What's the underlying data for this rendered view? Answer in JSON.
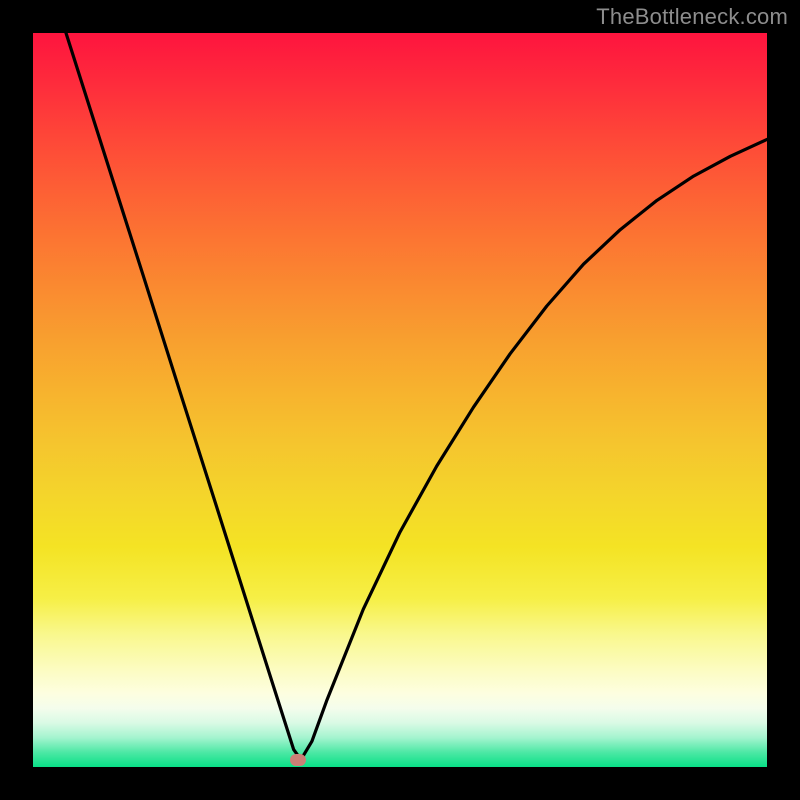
{
  "watermark": "TheBottleneck.com",
  "marker": {
    "x_frac": 0.3615,
    "y_frac": 0.9905
  },
  "chart_data": {
    "type": "line",
    "title": "",
    "xlabel": "",
    "ylabel": "",
    "xlim": [
      0,
      1
    ],
    "ylim": [
      0,
      1
    ],
    "series": [
      {
        "name": "bottleneck-curve",
        "x": [
          0.045,
          0.1,
          0.15,
          0.2,
          0.25,
          0.3,
          0.325,
          0.34,
          0.355,
          0.365,
          0.38,
          0.4,
          0.45,
          0.5,
          0.55,
          0.6,
          0.65,
          0.7,
          0.75,
          0.8,
          0.85,
          0.9,
          0.95,
          1.0
        ],
        "y": [
          1.0,
          0.827,
          0.67,
          0.512,
          0.355,
          0.197,
          0.118,
          0.071,
          0.024,
          0.01,
          0.035,
          0.09,
          0.215,
          0.32,
          0.41,
          0.49,
          0.563,
          0.628,
          0.685,
          0.732,
          0.772,
          0.805,
          0.832,
          0.855
        ]
      }
    ],
    "annotations": [
      {
        "name": "watermark",
        "text": "TheBottleneck.com",
        "pos": "top-right"
      }
    ],
    "gradient_stops": [
      {
        "pos": 0.0,
        "color": "#fe143e"
      },
      {
        "pos": 0.5,
        "color": "#f7b32e"
      },
      {
        "pos": 0.8,
        "color": "#f8f473"
      },
      {
        "pos": 1.0,
        "color": "#09e087"
      }
    ]
  }
}
